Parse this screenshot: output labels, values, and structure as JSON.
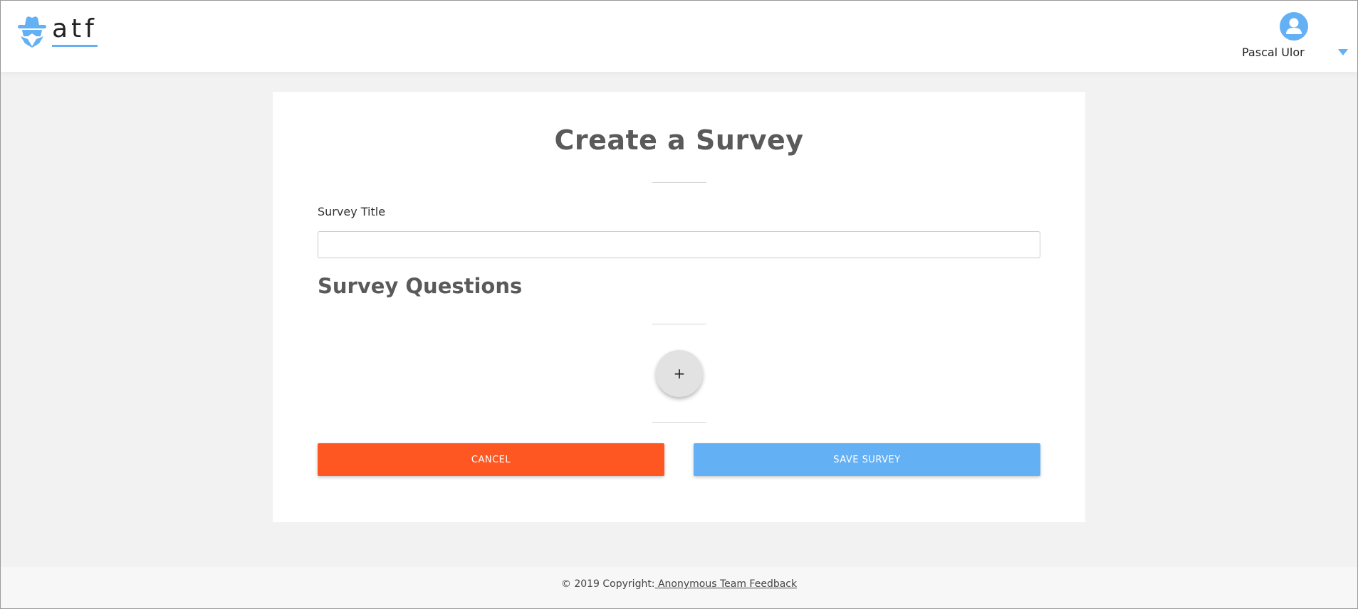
{
  "header": {
    "logo_text": "atf",
    "user": {
      "name": "Pascal Ulor"
    }
  },
  "main": {
    "title": "Create a Survey",
    "survey_title_label": "Survey Title",
    "survey_title_value": "",
    "survey_title_placeholder": "",
    "questions_title": "Survey Questions",
    "add_question_label": "+",
    "cancel_label": "CANCEL",
    "save_label": "SAVE SURVEY"
  },
  "footer": {
    "copyright": "© 2019 Copyright:",
    "link_text": " Anonymous Team Feedback"
  },
  "colors": {
    "accent_blue": "#64b0f5",
    "cancel_orange": "#ff5722",
    "heading_gray": "#5a5a5a",
    "background": "#f2f2f2"
  },
  "icons": {
    "logo": "spy-mask-icon",
    "avatar": "user-avatar-icon",
    "menu": "caret-down-icon"
  }
}
